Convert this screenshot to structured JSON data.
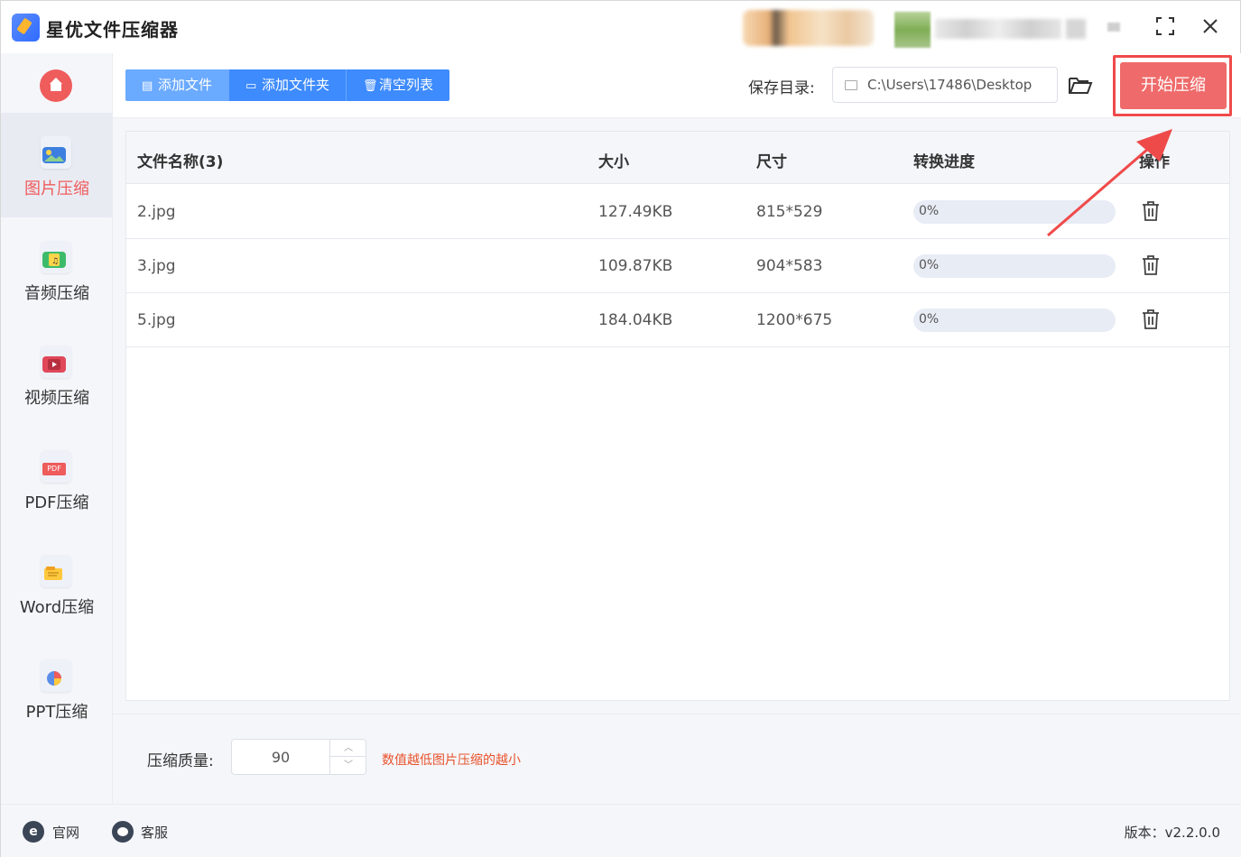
{
  "app": {
    "title": "星优文件压缩器"
  },
  "window": {
    "maximize_icon": "maximize-icon",
    "close_icon": "close-icon"
  },
  "sidebar": {
    "items": [
      {
        "label": "图片压缩",
        "icon": "image-icon",
        "active": true
      },
      {
        "label": "音频压缩",
        "icon": "audio-icon",
        "active": false
      },
      {
        "label": "视频压缩",
        "icon": "video-icon",
        "active": false
      },
      {
        "label": "PDF压缩",
        "icon": "pdf-icon",
        "badge": "PDF",
        "active": false
      },
      {
        "label": "Word压缩",
        "icon": "word-icon",
        "active": false
      },
      {
        "label": "PPT压缩",
        "icon": "ppt-icon",
        "active": false
      }
    ]
  },
  "toolbar": {
    "add_file": "添加文件",
    "add_folder": "添加文件夹",
    "clear_list": "清空列表",
    "save_label": "保存目录:",
    "save_path": "C:\\Users\\17486\\Desktop",
    "start": "开始压缩"
  },
  "table": {
    "headers": {
      "name": "文件名称(3)",
      "size": "大小",
      "dimensions": "尺寸",
      "progress": "转换进度",
      "action": "操作"
    },
    "rows": [
      {
        "name": "2.jpg",
        "size": "127.49KB",
        "dimensions": "815*529",
        "progress_text": "0%",
        "progress": 0
      },
      {
        "name": "3.jpg",
        "size": "109.87KB",
        "dimensions": "904*583",
        "progress_text": "0%",
        "progress": 0
      },
      {
        "name": "5.jpg",
        "size": "184.04KB",
        "dimensions": "1200*675",
        "progress_text": "0%",
        "progress": 0
      }
    ]
  },
  "quality": {
    "label": "压缩质量:",
    "value": "90",
    "hint": "数值越低图片压缩的越小"
  },
  "footer": {
    "website": "官网",
    "website_icon": "e",
    "support": "客服",
    "version": "版本：v2.2.0.0"
  },
  "colors": {
    "accent_blue": "#3d8bfd",
    "accent_red": "#ef5c5c",
    "hint_orange": "#e8522a"
  }
}
